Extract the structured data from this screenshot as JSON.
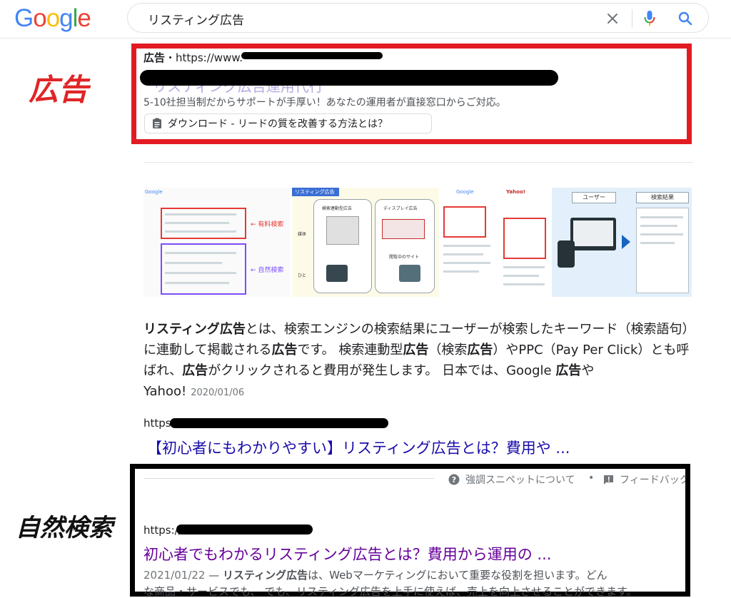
{
  "header": {
    "logo": "Google",
    "logo_colors": [
      "#4285F4",
      "#EA4335",
      "#FBBC05",
      "#4285F4",
      "#34A853",
      "#EA4335"
    ],
    "search_query": "リスティング広告",
    "icons": {
      "clear": "close-icon",
      "mic": "mic-icon",
      "search": "search-icon"
    }
  },
  "annotations": {
    "ad_label": "広告",
    "ad_box_color": "#e21b23",
    "organic_label": "自然検索",
    "organic_box_color": "#000000"
  },
  "ad": {
    "badge": "広告",
    "separator": "・",
    "url_prefix": "https://www.",
    "title_visible_fragment": "リスティング広告運用代行",
    "description": "5-10社担当制だからサポートが手厚い！あなたの運用者が直接窓口からご対応。",
    "sitelink": "ダウンロード - リードの質を改善する方法とは？"
  },
  "images": {
    "thumb1": {
      "logo": "Google",
      "label_paid": "有料検索",
      "label_natural": "自然検索"
    },
    "thumb2": {
      "header": "リスティング広告",
      "col_search": "検索連動型広告",
      "col_display": "ディスプレイ広告",
      "row_ad": "媒体",
      "row_people": "ひと",
      "site": "閲覧中のサイト"
    },
    "thumb3": {
      "logo": "Google"
    },
    "thumb4": {
      "logo": "Yahoo!"
    },
    "thumb5": {
      "user": "ユーザー",
      "results": "検索結果"
    }
  },
  "snippet": {
    "bold1": "リスティング広告",
    "text1": "とは、検索エンジンの検索結果にユーザーが検索したキーワード（検索語句）に連動して掲載される",
    "bold2": "広告",
    "text2": "です。 検索連動型",
    "bold3": "広告",
    "text3": "（検索",
    "bold4": "広告",
    "text4": "）やPPC（Pay Per Click）とも呼ばれ、",
    "bold5": "広告",
    "text5": "がクリックされると費用が発生します。 日本では、Google ",
    "bold6": "広告",
    "text6": "やYahoo!",
    "date": "2020/01/06",
    "source_url_prefix": "https:",
    "source_title": "【初心者にもわかりやすい】リスティング広告とは？費用や ..."
  },
  "featured_snippet_bar": {
    "about": "強調スニペットについて",
    "separator": "•",
    "feedback": "フィードバック"
  },
  "organic": {
    "url_prefix": "https://",
    "title": "初心者でもわかるリスティング広告とは？費用から運用の ...",
    "date": "2021/01/22",
    "dash": " — ",
    "bold": "リスティング広告",
    "desc": "は、Webマーケティングにおいて重要な役割を担います。どん",
    "desc2": "な商品・サービスでも、 でも、リスティング広告を上手に使えば、売上を向上させることができます。"
  }
}
